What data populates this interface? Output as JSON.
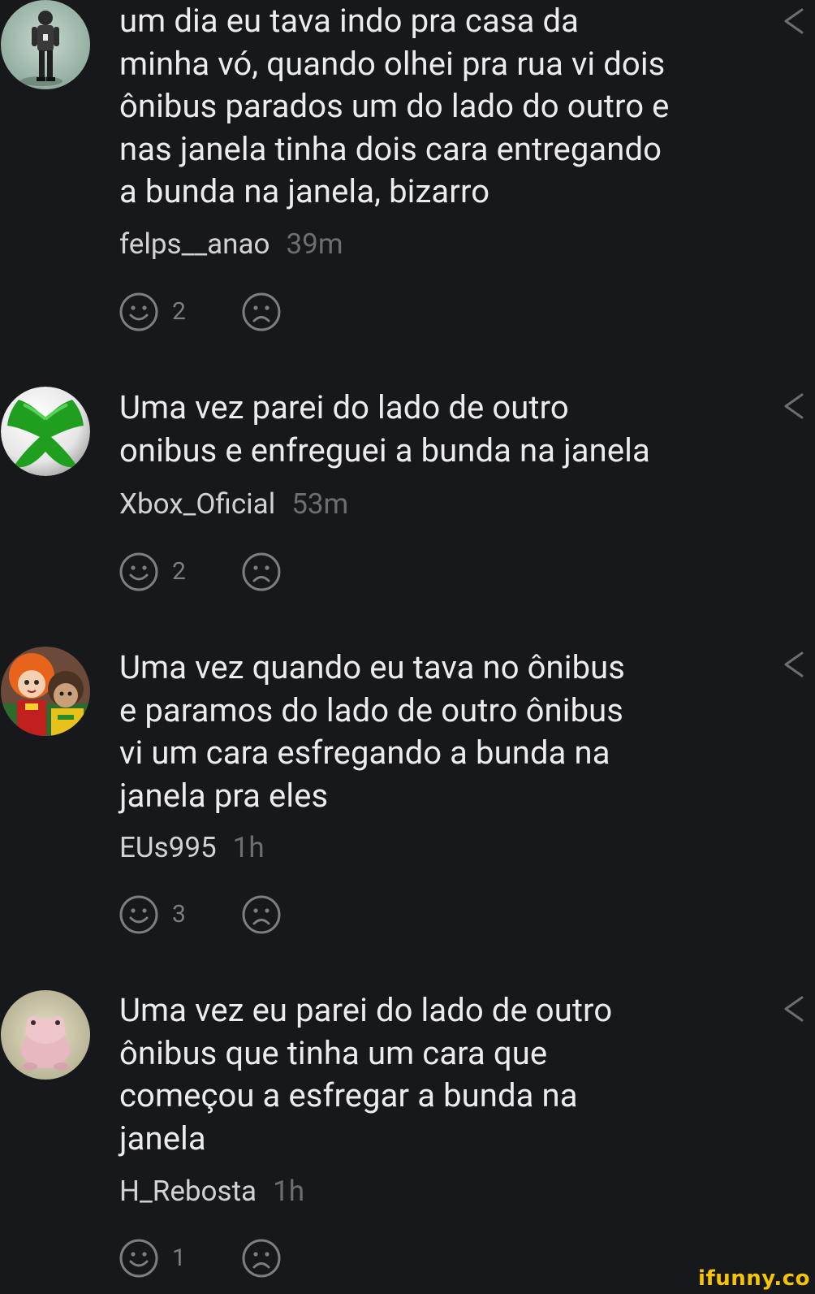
{
  "comments": [
    {
      "text": "um dia eu tava indo pra casa da\nminha vó, quando olhei pra rua vi dois\nônibus parados um do lado do outro e\nnas janela tinha dois cara entregando\na bunda na janela, bizarro",
      "username": "felps__anao",
      "time": "39m",
      "likes": "2",
      "avatar_icon": "person-standing-avatar"
    },
    {
      "text": "Uma vez parei do lado de outro\nonibus e enfreguei a bunda na janela",
      "username": "Xbox_Oficial",
      "time": "53m",
      "likes": "2",
      "avatar_icon": "xbox-logo-avatar"
    },
    {
      "text": "Uma vez quando eu tava no ônibus\ne paramos do lado de outro ônibus\nvi um cara esfregando a bunda na\njanela pra eles",
      "username": "EUs995",
      "time": "1h",
      "likes": "3",
      "avatar_icon": "anime-characters-avatar"
    },
    {
      "text": "Uma vez eu parei do lado de outro\nônibus que tinha um cara que\ncomeçou a esfregar a bunda na\njanela",
      "username": "H_Rebosta",
      "time": "1h",
      "likes": "1",
      "avatar_icon": "pink-frog-avatar"
    }
  ],
  "watermark": "ifunny.co",
  "colors": {
    "background": "#17181c",
    "text": "#ececef",
    "username": "#d2d2d6",
    "time": "#6d6e74",
    "icon": "#7d7e84",
    "watermark": "#f6c400"
  }
}
